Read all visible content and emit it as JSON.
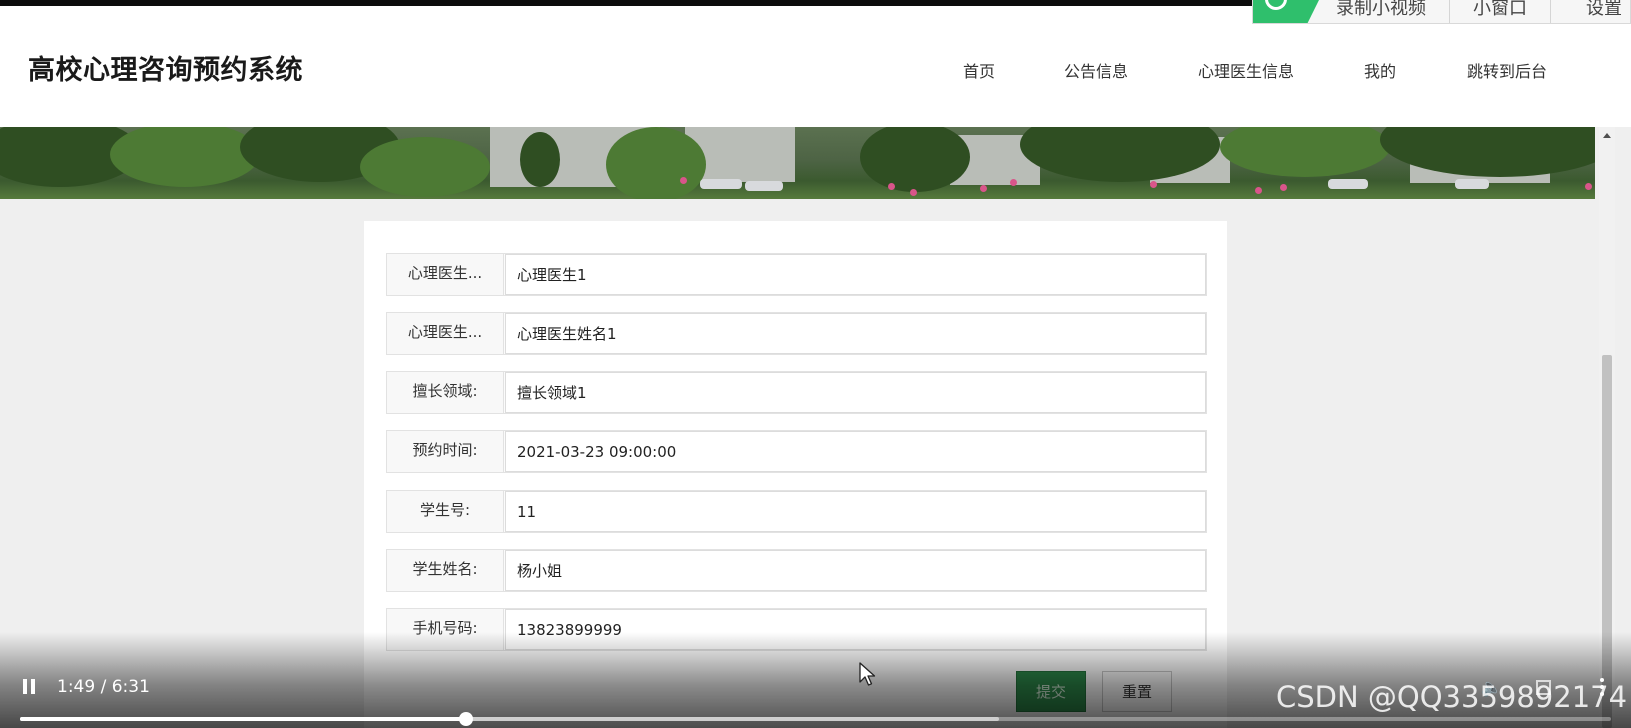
{
  "header": {
    "title": "高校心理咨询预约系统",
    "nav": [
      "首页",
      "公告信息",
      "心理医生信息",
      "我的",
      "跳转到后台"
    ]
  },
  "overlay_toolbar": {
    "items": [
      "录制小视频",
      "小窗口",
      "设置"
    ]
  },
  "form": {
    "fields": [
      {
        "label": "心理医生...",
        "value": "心理医生1"
      },
      {
        "label": "心理医生...",
        "value": "心理医生姓名1"
      },
      {
        "label": "擅长领域:",
        "value": "擅长领域1"
      },
      {
        "label": "预约时间:",
        "value": "2021-03-23 09:00:00"
      },
      {
        "label": "学生号:",
        "value": "11"
      },
      {
        "label": "学生姓名:",
        "value": "杨小姐"
      },
      {
        "label": "手机号码:",
        "value": "13823899999"
      }
    ],
    "submit_label": "提交",
    "reset_label": "重置"
  },
  "player": {
    "time": "1:49 / 6:31",
    "played_fraction": 0.2806,
    "buffered_fraction": 0.6154
  },
  "watermark": "CSDN @QQ3359892174",
  "colors": {
    "submit_bg": "#2d8a4a",
    "overlay_logo": "#2fbf6c",
    "page_bg": "#efefef"
  },
  "icons": [
    "pause-icon",
    "volume-icon",
    "fullscreen-icon",
    "more-icon",
    "scroll-up-icon",
    "cursor-icon"
  ]
}
